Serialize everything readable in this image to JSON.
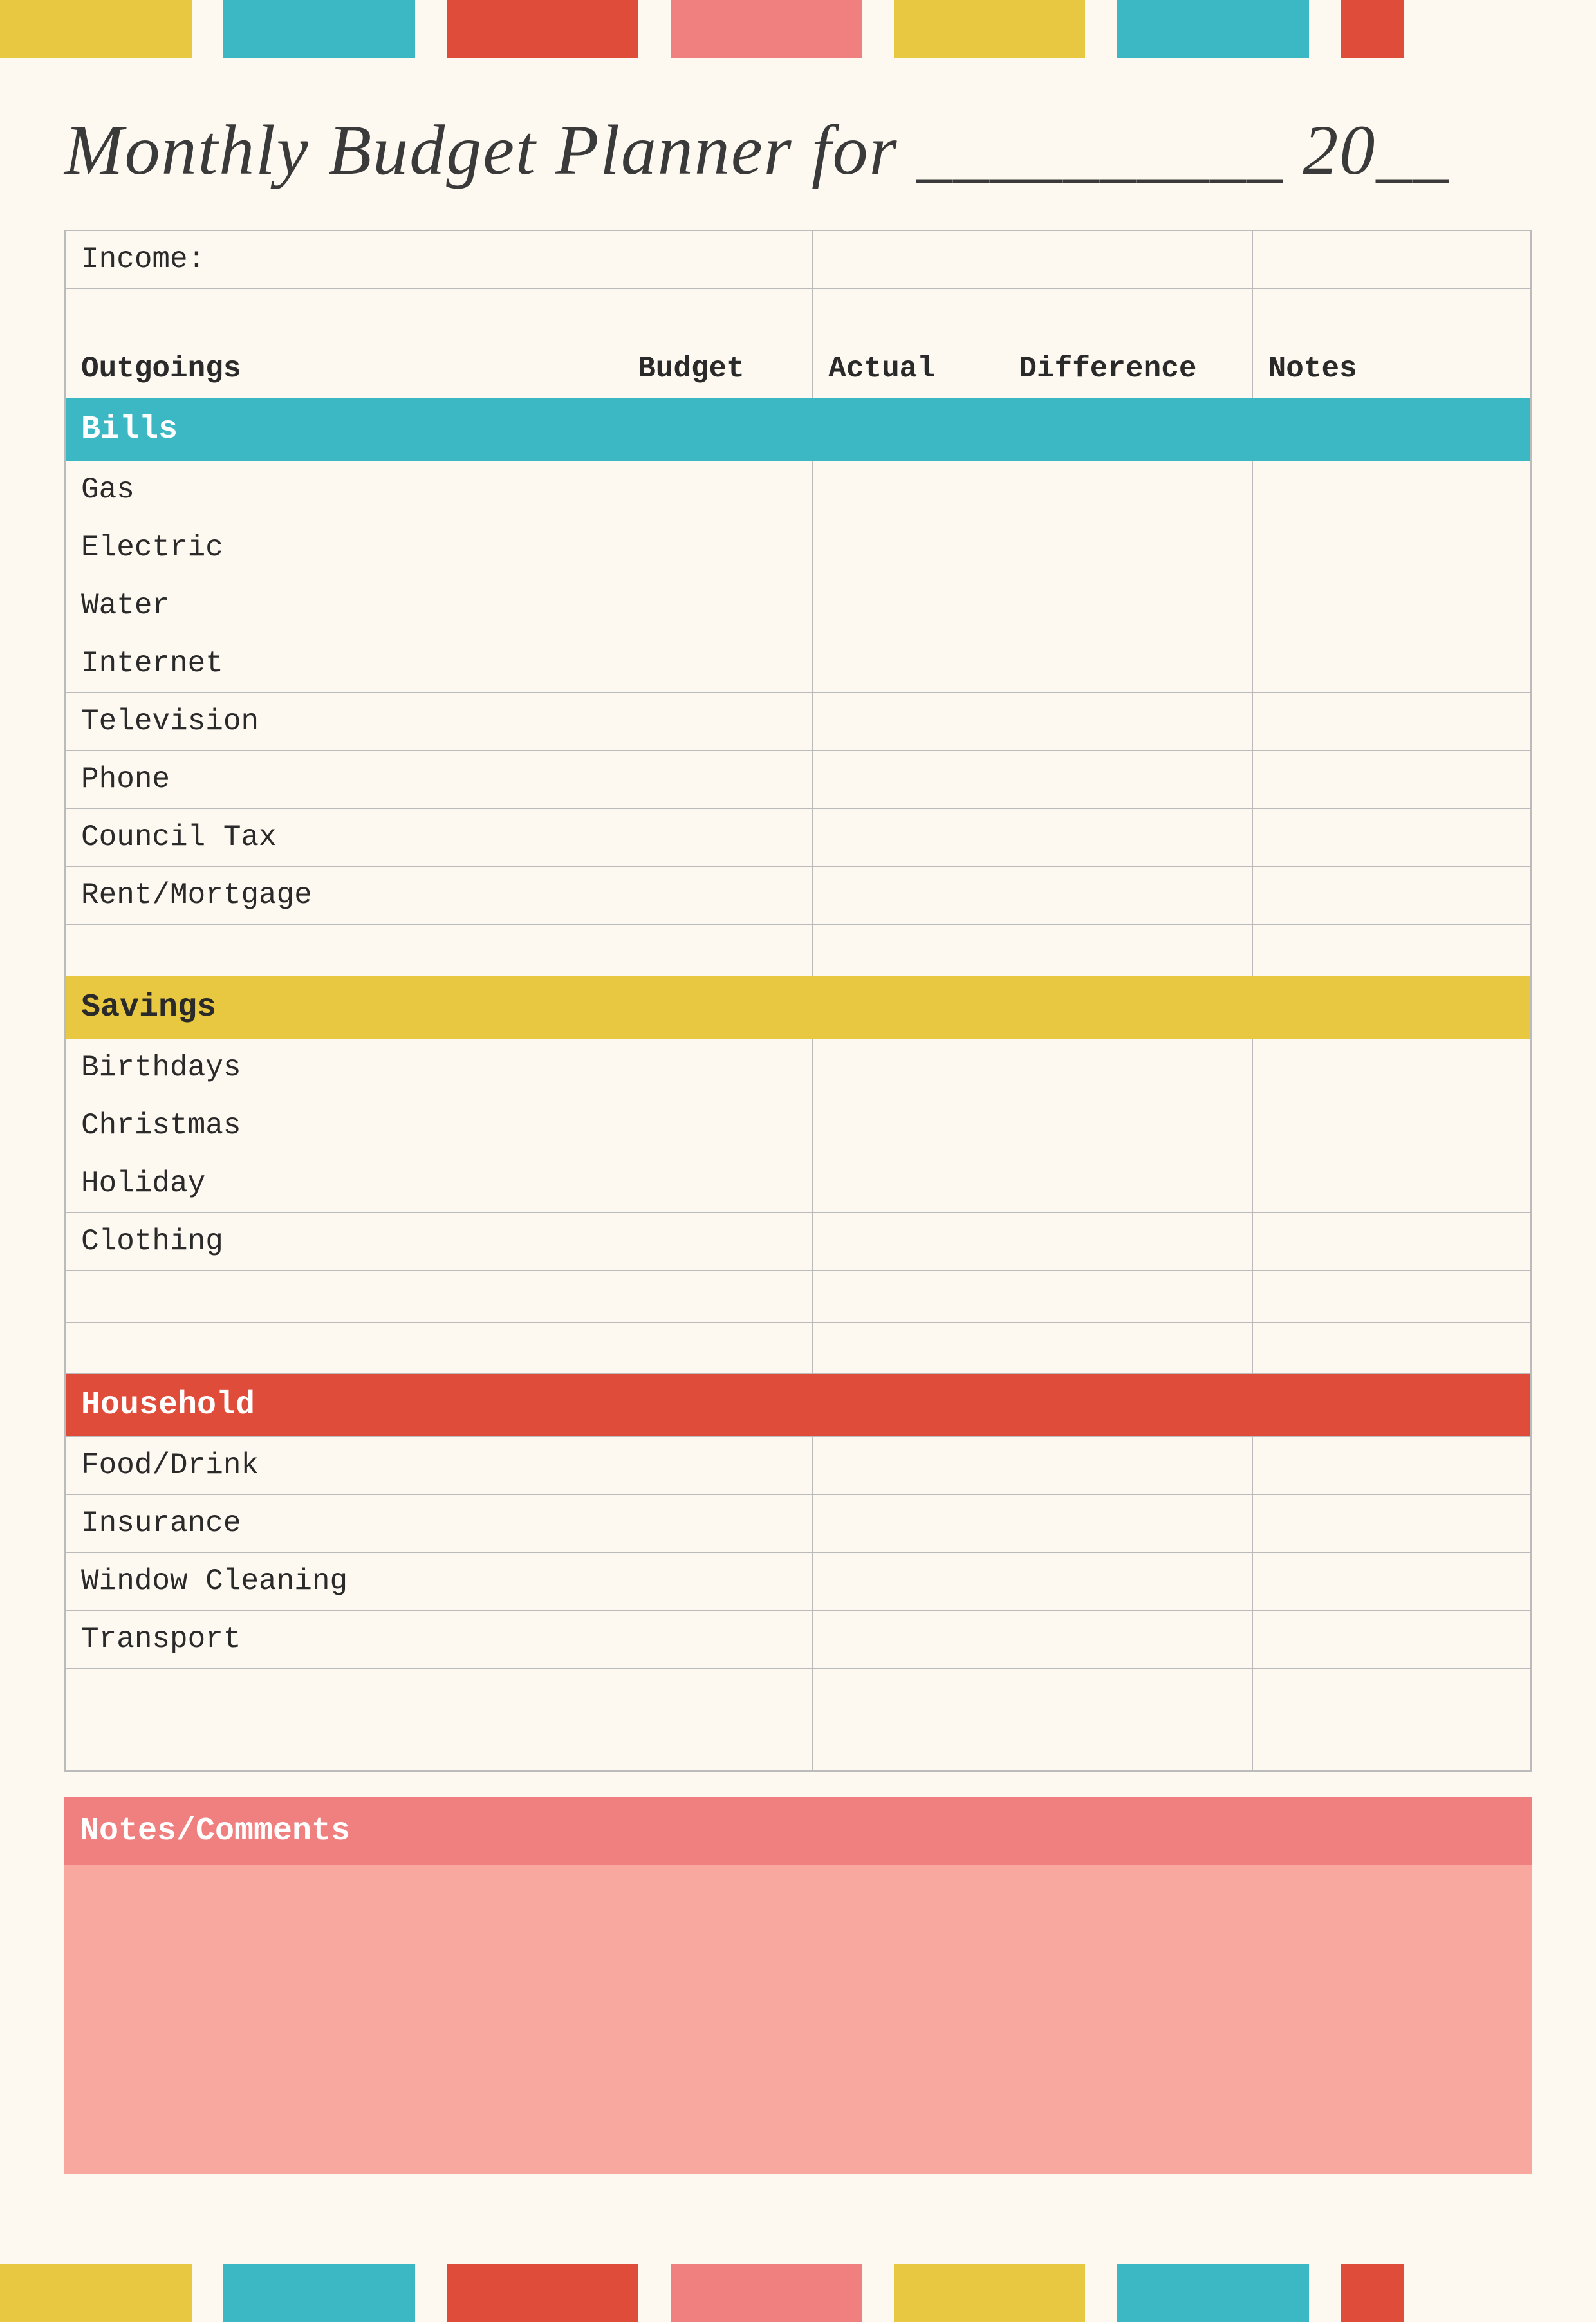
{
  "colors": {
    "yellow": "#e8c840",
    "teal": "#3bb8c3",
    "red": "#e04c3a",
    "pink": "#f08080",
    "light_pink": "#f9a8a0",
    "bg": "#fdf8f0"
  },
  "topBar": [
    {
      "color": "#e8c840",
      "width": "12%"
    },
    {
      "color": "#fdf8f0",
      "width": "2%"
    },
    {
      "color": "#3bb8c3",
      "width": "12%"
    },
    {
      "color": "#fdf8f0",
      "width": "2%"
    },
    {
      "color": "#e04c3a",
      "width": "12%"
    },
    {
      "color": "#fdf8f0",
      "width": "2%"
    },
    {
      "color": "#f08080",
      "width": "12%"
    },
    {
      "color": "#fdf8f0",
      "width": "2%"
    },
    {
      "color": "#e8c840",
      "width": "12%"
    },
    {
      "color": "#fdf8f0",
      "width": "2%"
    },
    {
      "color": "#3bb8c3",
      "width": "12%"
    },
    {
      "color": "#fdf8f0",
      "width": "2%"
    },
    {
      "color": "#e04c3a",
      "width": "12%"
    },
    {
      "color": "#fdf8f0",
      "width": "2%"
    }
  ],
  "title": {
    "text": "Monthly Budget Planner for __________ 20__"
  },
  "table": {
    "headers": {
      "label": "Outgoings",
      "budget": "Budget",
      "actual": "Actual",
      "difference": "Difference",
      "notes": "Notes"
    },
    "income_label": "Income:",
    "sections": [
      {
        "name": "Bills",
        "color": "teal",
        "items": [
          "Gas",
          "Electric",
          "Water",
          "Internet",
          "Television",
          "Phone",
          "Council Tax",
          "Rent/Mortgage"
        ]
      },
      {
        "name": "Savings",
        "color": "yellow",
        "items": [
          "Birthdays",
          "Christmas",
          "Holiday",
          "Clothing"
        ]
      },
      {
        "name": "Household",
        "color": "red",
        "items": [
          "Food/Drink",
          "Insurance",
          "Window Cleaning",
          "Transport"
        ]
      }
    ]
  },
  "notes": {
    "header": "Notes/Comments"
  }
}
